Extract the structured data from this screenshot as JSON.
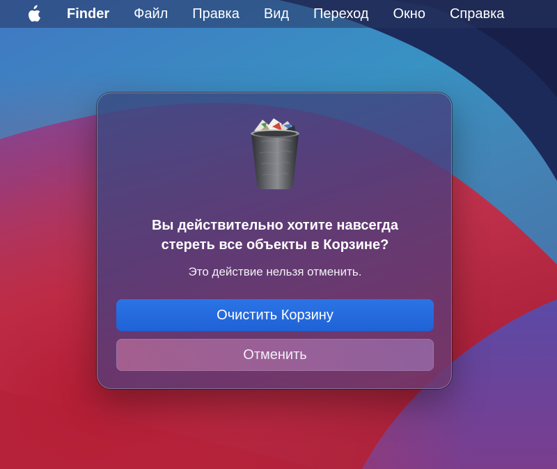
{
  "menubar": {
    "apple_icon": "apple-logo-icon",
    "app_name": "Finder",
    "items": [
      {
        "label": "Файл"
      },
      {
        "label": "Правка"
      },
      {
        "label": "Вид"
      },
      {
        "label": "Переход"
      },
      {
        "label": "Окно"
      },
      {
        "label": "Справка"
      }
    ]
  },
  "dialog": {
    "icon": "trash-full-icon",
    "title_line1": "Вы действительно хотите навсегда",
    "title_line2": "стереть все объекты в Корзине?",
    "message": "Это действие нельзя отменить.",
    "confirm_label": "Очистить Корзину",
    "cancel_label": "Отменить"
  },
  "colors": {
    "primary_button": "#2268dc",
    "menubar_text": "#ffffff"
  }
}
